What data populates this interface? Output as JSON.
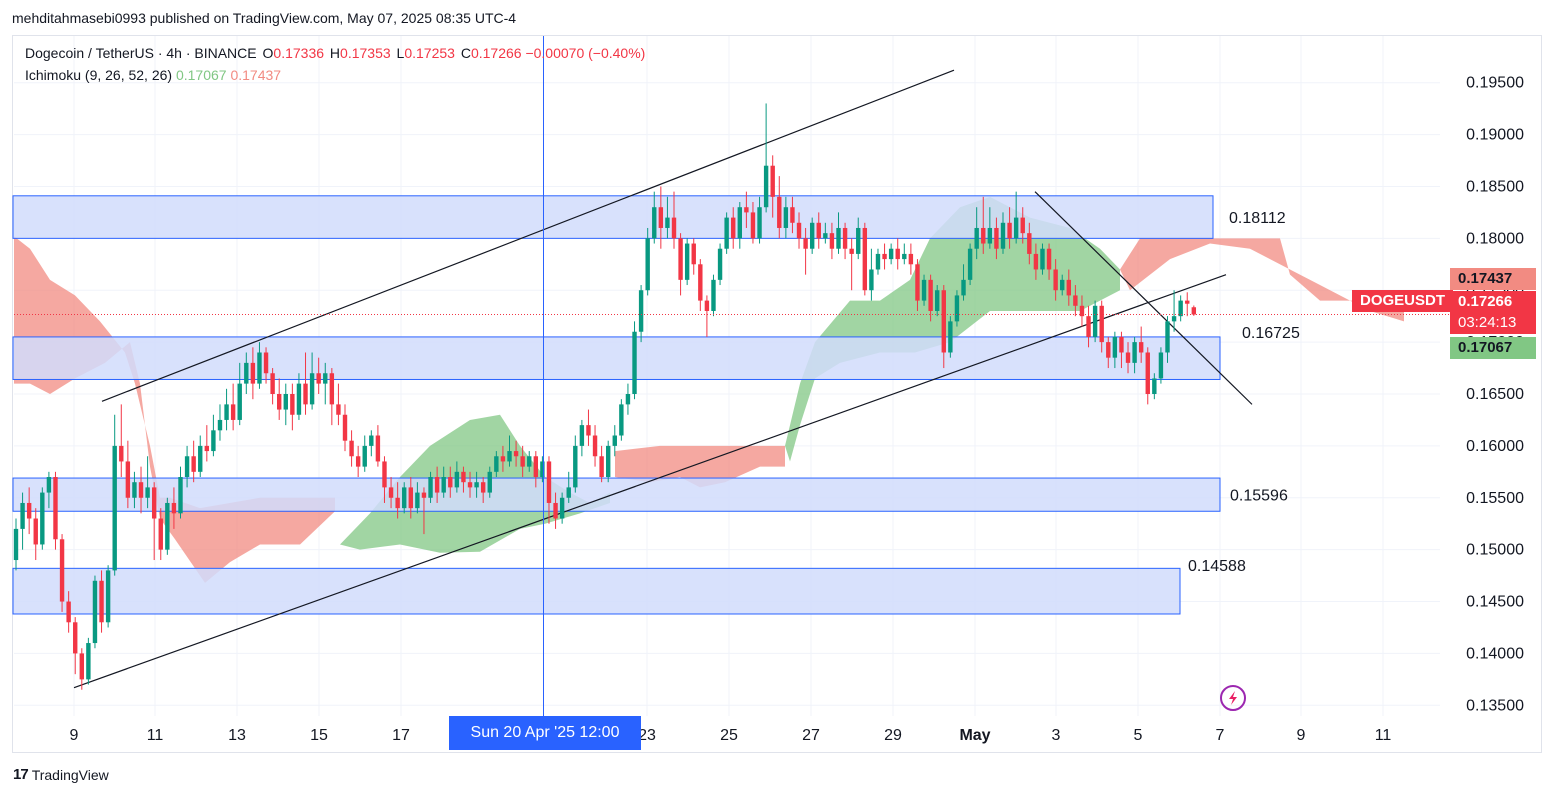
{
  "header": {
    "published": "mehditahmasebi0993 published on TradingView.com, May 07, 2025 08:35 UTC-4"
  },
  "legend": {
    "symbol": "Dogecoin / TetherUS · 4h · BINANCE",
    "o_label": "O",
    "o_value": "0.17336",
    "h_label": "H",
    "h_value": "0.17353",
    "l_label": "L",
    "l_value": "0.17253",
    "c_label": "C",
    "c_value": "0.17266",
    "change": "−0.00070 (−0.40%)",
    "indicator": "Ichimoku (9, 26, 52, 26)",
    "ind_v1": "0.17067",
    "ind_v2": "0.17437"
  },
  "crosshair": {
    "label": "Sun 20 Apr '25   12:00"
  },
  "badges": {
    "symbol": "DOGEUSDT",
    "price": "0.17266",
    "countdown": "03:24:13",
    "span_b": "0.17437",
    "span_a": "0.17067"
  },
  "footer": {
    "brand": "TradingView"
  },
  "colors": {
    "bull": "#089981",
    "bear": "#f23645",
    "cloud_bull": "#81c784",
    "cloud_bear": "#f28b82",
    "zone_fill": "#d1dcfb",
    "zone_border": "#2962ff",
    "grid": "#f0f3fa"
  },
  "chart_data": {
    "type": "candlestick",
    "x_ticks": [
      "9",
      "11",
      "13",
      "15",
      "17",
      "23",
      "25",
      "27",
      "29",
      "May",
      "3",
      "5",
      "7",
      "9",
      "11"
    ],
    "y_ticks": [
      "0.19500",
      "0.19000",
      "0.18500",
      "0.18000",
      "0.17500",
      "0.17000",
      "0.16500",
      "0.16000",
      "0.15500",
      "0.15000",
      "0.14500",
      "0.14000",
      "0.13500"
    ],
    "y_tick_values": [
      0.195,
      0.19,
      0.185,
      0.18,
      0.175,
      0.17,
      0.165,
      0.16,
      0.155,
      0.15,
      0.145,
      0.14,
      0.135
    ],
    "ylim": [
      0.1305,
      0.1995
    ],
    "zones": [
      {
        "top": 0.1841,
        "bottom": 0.18,
        "label": "0.18112"
      },
      {
        "top": 0.1705,
        "bottom": 0.1664,
        "label": "0.16725"
      },
      {
        "top": 0.1569,
        "bottom": 0.1537,
        "label": "0.15596"
      },
      {
        "top": 0.1482,
        "bottom": 0.1438,
        "label": "0.14588"
      }
    ],
    "trendlines": [
      {
        "name": "channel-upper",
        "p1": [
          "9",
          0.1643
        ],
        "p2": [
          "May",
          0.1962
        ]
      },
      {
        "name": "channel-lower",
        "p1": [
          "9",
          0.1367
        ],
        "p2": [
          "7",
          0.1765
        ]
      },
      {
        "name": "descending",
        "p1": [
          "May",
          0.1845
        ],
        "p2": [
          "7",
          0.164
        ]
      }
    ],
    "last_price": 0.17266,
    "candles": [
      [
        0.149,
        0.152,
        0.148,
        0.153
      ],
      [
        0.152,
        0.1545,
        0.15,
        0.1555
      ],
      [
        0.1545,
        0.153,
        0.1515,
        0.156
      ],
      [
        0.153,
        0.1505,
        0.149,
        0.154
      ],
      [
        0.1505,
        0.1555,
        0.15,
        0.156
      ],
      [
        0.1555,
        0.157,
        0.154,
        0.1575
      ],
      [
        0.157,
        0.151,
        0.15,
        0.1575
      ],
      [
        0.151,
        0.145,
        0.144,
        0.1515
      ],
      [
        0.145,
        0.143,
        0.142,
        0.146
      ],
      [
        0.143,
        0.14,
        0.138,
        0.1435
      ],
      [
        0.14,
        0.1375,
        0.1365,
        0.1405
      ],
      [
        0.1375,
        0.141,
        0.137,
        0.1415
      ],
      [
        0.141,
        0.147,
        0.1405,
        0.1475
      ],
      [
        0.147,
        0.143,
        0.142,
        0.148
      ],
      [
        0.143,
        0.148,
        0.1425,
        0.1485
      ],
      [
        0.148,
        0.16,
        0.1475,
        0.163
      ],
      [
        0.16,
        0.1585,
        0.157,
        0.164
      ],
      [
        0.1585,
        0.155,
        0.154,
        0.1605
      ],
      [
        0.155,
        0.1565,
        0.154,
        0.1575
      ],
      [
        0.1565,
        0.155,
        0.1535,
        0.158
      ],
      [
        0.155,
        0.156,
        0.154,
        0.159
      ],
      [
        0.156,
        0.153,
        0.149,
        0.1565
      ],
      [
        0.153,
        0.15,
        0.149,
        0.154
      ],
      [
        0.15,
        0.1545,
        0.1495,
        0.155
      ],
      [
        0.1545,
        0.1535,
        0.152,
        0.156
      ],
      [
        0.1535,
        0.157,
        0.153,
        0.158
      ],
      [
        0.157,
        0.159,
        0.156,
        0.16
      ],
      [
        0.159,
        0.1575,
        0.1565,
        0.1605
      ],
      [
        0.1575,
        0.16,
        0.157,
        0.161
      ],
      [
        0.16,
        0.1595,
        0.1585,
        0.162
      ],
      [
        0.1595,
        0.1615,
        0.159,
        0.163
      ],
      [
        0.1615,
        0.1625,
        0.1605,
        0.164
      ],
      [
        0.1625,
        0.164,
        0.1615,
        0.1655
      ],
      [
        0.164,
        0.1625,
        0.1615,
        0.166
      ],
      [
        0.1625,
        0.166,
        0.162,
        0.168
      ],
      [
        0.166,
        0.168,
        0.165,
        0.169
      ],
      [
        0.168,
        0.166,
        0.1645,
        0.1695
      ],
      [
        0.166,
        0.169,
        0.1655,
        0.17
      ],
      [
        0.169,
        0.167,
        0.166,
        0.1695
      ],
      [
        0.167,
        0.165,
        0.164,
        0.1675
      ],
      [
        0.165,
        0.1635,
        0.1625,
        0.1665
      ],
      [
        0.1635,
        0.165,
        0.162,
        0.166
      ],
      [
        0.165,
        0.163,
        0.1615,
        0.166
      ],
      [
        0.163,
        0.166,
        0.1625,
        0.167
      ],
      [
        0.166,
        0.164,
        0.163,
        0.169
      ],
      [
        0.164,
        0.167,
        0.1635,
        0.169
      ],
      [
        0.167,
        0.166,
        0.165,
        0.1685
      ],
      [
        0.166,
        0.167,
        0.164,
        0.168
      ],
      [
        0.167,
        0.164,
        0.162,
        0.1675
      ],
      [
        0.164,
        0.163,
        0.162,
        0.166
      ],
      [
        0.163,
        0.1605,
        0.1595,
        0.164
      ],
      [
        0.1605,
        0.159,
        0.158,
        0.1615
      ],
      [
        0.159,
        0.158,
        0.157,
        0.16
      ],
      [
        0.158,
        0.16,
        0.1575,
        0.161
      ],
      [
        0.16,
        0.161,
        0.159,
        0.1615
      ],
      [
        0.161,
        0.1585,
        0.158,
        0.162
      ],
      [
        0.1585,
        0.156,
        0.1545,
        0.159
      ],
      [
        0.156,
        0.155,
        0.154,
        0.157
      ],
      [
        0.155,
        0.154,
        0.153,
        0.1565
      ],
      [
        0.154,
        0.156,
        0.1535,
        0.1565
      ],
      [
        0.156,
        0.154,
        0.153,
        0.157
      ],
      [
        0.154,
        0.1555,
        0.1535,
        0.1565
      ],
      [
        0.1555,
        0.155,
        0.1515,
        0.156
      ],
      [
        0.155,
        0.157,
        0.1545,
        0.1575
      ],
      [
        0.157,
        0.1555,
        0.1545,
        0.158
      ],
      [
        0.1555,
        0.157,
        0.155,
        0.158
      ],
      [
        0.157,
        0.156,
        0.155,
        0.158
      ],
      [
        0.156,
        0.1575,
        0.1555,
        0.1585
      ],
      [
        0.1575,
        0.1565,
        0.1555,
        0.158
      ],
      [
        0.1565,
        0.156,
        0.155,
        0.1575
      ],
      [
        0.156,
        0.1565,
        0.155,
        0.1575
      ],
      [
        0.1565,
        0.1555,
        0.1545,
        0.157
      ],
      [
        0.1555,
        0.1575,
        0.155,
        0.158
      ],
      [
        0.1575,
        0.159,
        0.157,
        0.1595
      ],
      [
        0.159,
        0.1585,
        0.1575,
        0.16
      ],
      [
        0.1585,
        0.1595,
        0.158,
        0.161
      ],
      [
        0.1595,
        0.159,
        0.158,
        0.1605
      ],
      [
        0.159,
        0.158,
        0.157,
        0.16
      ],
      [
        0.158,
        0.159,
        0.1575,
        0.1595
      ],
      [
        0.159,
        0.157,
        0.156,
        0.1595
      ],
      [
        0.157,
        0.1585,
        0.1565,
        0.159
      ],
      [
        0.1585,
        0.1545,
        0.1525,
        0.159
      ],
      [
        0.1545,
        0.153,
        0.152,
        0.1555
      ],
      [
        0.153,
        0.155,
        0.1525,
        0.1555
      ],
      [
        0.155,
        0.156,
        0.1545,
        0.1575
      ],
      [
        0.156,
        0.16,
        0.1555,
        0.161
      ],
      [
        0.16,
        0.162,
        0.159,
        0.1625
      ],
      [
        0.162,
        0.161,
        0.16,
        0.1635
      ],
      [
        0.161,
        0.159,
        0.158,
        0.162
      ],
      [
        0.159,
        0.157,
        0.1565,
        0.16
      ],
      [
        0.157,
        0.16,
        0.1565,
        0.1605
      ],
      [
        0.16,
        0.161,
        0.159,
        0.162
      ],
      [
        0.161,
        0.164,
        0.1605,
        0.1645
      ],
      [
        0.164,
        0.165,
        0.163,
        0.166
      ],
      [
        0.165,
        0.171,
        0.1645,
        0.172
      ],
      [
        0.171,
        0.175,
        0.17,
        0.1755
      ],
      [
        0.175,
        0.18,
        0.1745,
        0.181
      ],
      [
        0.18,
        0.183,
        0.1795,
        0.1845
      ],
      [
        0.183,
        0.181,
        0.179,
        0.185
      ],
      [
        0.181,
        0.182,
        0.18,
        0.184
      ],
      [
        0.182,
        0.18,
        0.179,
        0.1845
      ],
      [
        0.18,
        0.176,
        0.1745,
        0.1805
      ],
      [
        0.176,
        0.1795,
        0.1755,
        0.18
      ],
      [
        0.1795,
        0.1775,
        0.1765,
        0.18
      ],
      [
        0.1775,
        0.174,
        0.173,
        0.178
      ],
      [
        0.174,
        0.173,
        0.1705,
        0.1745
      ],
      [
        0.173,
        0.176,
        0.1725,
        0.1765
      ],
      [
        0.176,
        0.179,
        0.1755,
        0.1795
      ],
      [
        0.179,
        0.182,
        0.1785,
        0.1825
      ],
      [
        0.182,
        0.18,
        0.179,
        0.183
      ],
      [
        0.18,
        0.183,
        0.179,
        0.1835
      ],
      [
        0.183,
        0.1825,
        0.181,
        0.1845
      ],
      [
        0.1825,
        0.18,
        0.1795,
        0.1835
      ],
      [
        0.18,
        0.183,
        0.1795,
        0.184
      ],
      [
        0.183,
        0.187,
        0.1825,
        0.193
      ],
      [
        0.187,
        0.184,
        0.182,
        0.188
      ],
      [
        0.184,
        0.181,
        0.18,
        0.186
      ],
      [
        0.181,
        0.183,
        0.18,
        0.184
      ],
      [
        0.183,
        0.1815,
        0.1805,
        0.184
      ],
      [
        0.1815,
        0.18,
        0.179,
        0.1825
      ],
      [
        0.18,
        0.179,
        0.1765,
        0.181
      ],
      [
        0.179,
        0.1815,
        0.1785,
        0.182
      ],
      [
        0.1815,
        0.18,
        0.179,
        0.1825
      ],
      [
        0.18,
        0.1805,
        0.1795,
        0.1815
      ],
      [
        0.1805,
        0.179,
        0.178,
        0.1815
      ],
      [
        0.179,
        0.181,
        0.1785,
        0.1825
      ],
      [
        0.181,
        0.179,
        0.178,
        0.1815
      ],
      [
        0.179,
        0.1785,
        0.175,
        0.18
      ],
      [
        0.1785,
        0.181,
        0.178,
        0.182
      ],
      [
        0.181,
        0.175,
        0.1745,
        0.1815
      ],
      [
        0.175,
        0.177,
        0.174,
        0.179
      ],
      [
        0.177,
        0.1785,
        0.1765,
        0.179
      ],
      [
        0.1785,
        0.178,
        0.177,
        0.1795
      ],
      [
        0.178,
        0.179,
        0.1775,
        0.1795
      ],
      [
        0.179,
        0.178,
        0.177,
        0.18
      ],
      [
        0.178,
        0.1785,
        0.1775,
        0.1795
      ],
      [
        0.1785,
        0.1775,
        0.1765,
        0.1795
      ],
      [
        0.1775,
        0.174,
        0.173,
        0.178
      ],
      [
        0.174,
        0.176,
        0.1735,
        0.1765
      ],
      [
        0.176,
        0.173,
        0.172,
        0.1765
      ],
      [
        0.173,
        0.175,
        0.1725,
        0.1755
      ],
      [
        0.175,
        0.169,
        0.1675,
        0.1755
      ],
      [
        0.169,
        0.172,
        0.1685,
        0.1725
      ],
      [
        0.172,
        0.1745,
        0.1715,
        0.175
      ],
      [
        0.1745,
        0.176,
        0.174,
        0.1775
      ],
      [
        0.176,
        0.179,
        0.1755,
        0.1795
      ],
      [
        0.179,
        0.181,
        0.178,
        0.183
      ],
      [
        0.181,
        0.1795,
        0.1785,
        0.184
      ],
      [
        0.1795,
        0.181,
        0.179,
        0.183
      ],
      [
        0.181,
        0.179,
        0.178,
        0.182
      ],
      [
        0.179,
        0.1815,
        0.1785,
        0.1825
      ],
      [
        0.1815,
        0.18,
        0.179,
        0.183
      ],
      [
        0.18,
        0.182,
        0.1795,
        0.1845
      ],
      [
        0.182,
        0.1805,
        0.1795,
        0.183
      ],
      [
        0.1805,
        0.1785,
        0.1775,
        0.1815
      ],
      [
        0.1785,
        0.177,
        0.176,
        0.1795
      ],
      [
        0.177,
        0.179,
        0.1765,
        0.1795
      ],
      [
        0.179,
        0.177,
        0.176,
        0.1795
      ],
      [
        0.177,
        0.175,
        0.174,
        0.178
      ],
      [
        0.175,
        0.176,
        0.1745,
        0.1765
      ],
      [
        0.176,
        0.1745,
        0.1735,
        0.177
      ],
      [
        0.1745,
        0.1735,
        0.1725,
        0.1755
      ],
      [
        0.1735,
        0.1725,
        0.1715,
        0.1745
      ],
      [
        0.1725,
        0.1705,
        0.1695,
        0.1735
      ],
      [
        0.1705,
        0.1735,
        0.17,
        0.174
      ],
      [
        0.1735,
        0.17,
        0.169,
        0.174
      ],
      [
        0.17,
        0.1685,
        0.1675,
        0.1705
      ],
      [
        0.1685,
        0.1705,
        0.1675,
        0.171
      ],
      [
        0.1705,
        0.169,
        0.1675,
        0.171
      ],
      [
        0.169,
        0.168,
        0.167,
        0.17
      ],
      [
        0.168,
        0.17,
        0.167,
        0.1705
      ],
      [
        0.17,
        0.169,
        0.168,
        0.1715
      ],
      [
        0.169,
        0.165,
        0.164,
        0.1695
      ],
      [
        0.165,
        0.1665,
        0.1645,
        0.167
      ],
      [
        0.1665,
        0.169,
        0.166,
        0.1695
      ],
      [
        0.169,
        0.172,
        0.168,
        0.1725
      ],
      [
        0.172,
        0.1725,
        0.171,
        0.175
      ],
      [
        0.1725,
        0.174,
        0.172,
        0.1745
      ],
      [
        0.174,
        0.1737,
        0.1725,
        0.1748
      ],
      [
        0.17336,
        0.17266,
        0.17253,
        0.17353
      ]
    ]
  }
}
